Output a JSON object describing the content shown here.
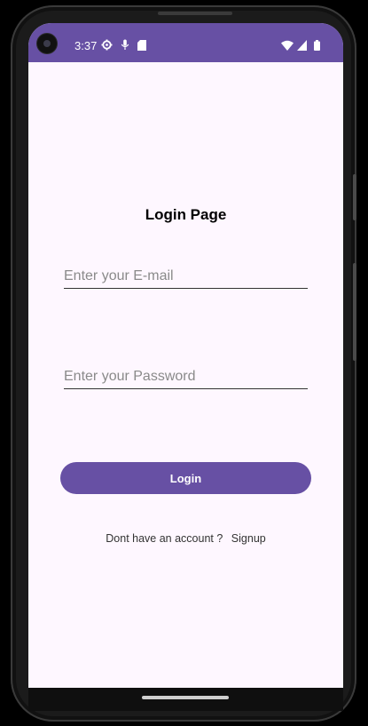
{
  "status_bar": {
    "time": "3:37",
    "color": "#6750a4",
    "icons_left": [
      "settings-gear-icon",
      "microphone-icon",
      "sd-card-icon"
    ],
    "icons_right": [
      "wifi-icon",
      "cellular-signal-icon",
      "battery-icon"
    ]
  },
  "login_page": {
    "title": "Login Page",
    "email_placeholder": "Enter your E-mail",
    "password_placeholder": "Enter your Password",
    "login_button_label": "Login",
    "signup_prompt": "Dont have an account ?",
    "signup_link": "Signup",
    "accent_color": "#6750a4",
    "background_color": "#fef7ff"
  }
}
